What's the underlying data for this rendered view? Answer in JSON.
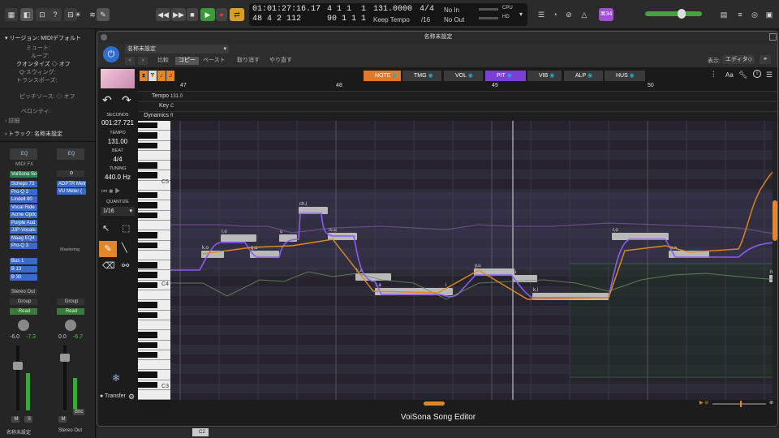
{
  "topbar": {
    "time": "01:01:27:16.17",
    "bar_top": "4 1 1",
    "beat_top": "1",
    "bar_bottom": "48 4 2 112",
    "sub_bottom": "90 1 1",
    "beat_bottom": "1",
    "tempo": "131.0000",
    "tempo_mode": "Keep Tempo",
    "signature": "4/4",
    "division": "/16",
    "in_label": "No In",
    "out_label": "No Out",
    "cpu_label": "CPU",
    "hd_label": "HD",
    "badge": "⌘34"
  },
  "inspector": {
    "region_label": "リージョン: MIDIデフォルト",
    "mute_label": "ミュート:",
    "loop_label": "ループ:",
    "quantize_label": "クオンタイズ",
    "quantize_value": "オフ",
    "qswing_label": "Q-スウィング:",
    "transpose_label": "トランスポーズ:",
    "pitchsource_label": "ピッチソース:",
    "pitchsource_value": "オフ",
    "velocity_label": "ベロシティ:",
    "detail_label": "詳細",
    "track_label": "トラック: 名称未設定",
    "eq_label": "EQ",
    "midi_fx": "MIDI FX",
    "instrument": "VoiSona So",
    "plugins": [
      "Scheps 73",
      "Pro-Q 3",
      "Lindell 80",
      "Vocal Ride",
      "Acme Optic",
      "Purple Aud",
      "JJP-Vocals",
      "Maag EQ4",
      "Pro-Q 3"
    ],
    "plugins_right": [
      "ADPTR Metr",
      "VU Meter ("
    ],
    "mastering": "Mastering",
    "sends": [
      "Bus 1",
      "B 13",
      "B 30"
    ],
    "output": "Stereo Out",
    "group": "Group",
    "automation": "Read",
    "pan_l": "-6.0",
    "pan_r": "-7.3",
    "pan_l2": "0.0",
    "pan_r2": "-6.7",
    "bnc": "Bnc",
    "m": "M",
    "s": "S",
    "strip1_name": "名称未設定",
    "strip2_name": "Stereo Out"
  },
  "plugin": {
    "title": "名称未設定",
    "project": "名称未設定",
    "menu": [
      "比較",
      "コピー",
      "ペースト",
      "取り消す",
      "やり直す"
    ],
    "display_label": "表示:",
    "display_value": "エディタ",
    "tabs": [
      {
        "label": "NOTE",
        "color": "#e07a2a"
      },
      {
        "label": "TMG",
        "color": "#3a3a3a"
      },
      {
        "label": "VOL",
        "color": "#3a3a3a"
      },
      {
        "label": "PIT",
        "color": "#7b3fd6"
      },
      {
        "label": "VIB",
        "color": "#3a3a3a"
      },
      {
        "label": "ALP",
        "color": "#3a3a3a"
      },
      {
        "label": "HUS",
        "color": "#3a3a3a"
      }
    ],
    "aa": "Aa",
    "seconds_label": "SECONDS",
    "seconds_value": "001:27.721",
    "tempo_label": "TEMPO",
    "tempo_value": "131.00",
    "beat_label": "BEAT",
    "beat_value": "4/4",
    "tuning_label": "TUNING",
    "tuning_value": "440.0 Hz",
    "quantize_label": "QUANTIZE",
    "quantize_value": "1/16",
    "transfer_label": "Transfer",
    "row_labels": [
      "Tempo",
      "Key",
      "Dynamics"
    ],
    "tempo_row_value": "131.0",
    "key_row_value": "C",
    "dyn_row_value": "ff",
    "bars": [
      "47",
      "48",
      "49",
      "50"
    ],
    "octaves": [
      "C5",
      "C4",
      "C3"
    ],
    "footer": "VoiSona Song Editor",
    "notes": [
      "k,o",
      "r,o",
      "g,a",
      "o",
      "ch,i",
      "ts,u",
      "k,a",
      "r,a",
      "i",
      "y,u",
      "u",
      "k,i",
      "r,o",
      "w,a",
      "h"
    ]
  },
  "bottom": {
    "c2": "C2"
  }
}
